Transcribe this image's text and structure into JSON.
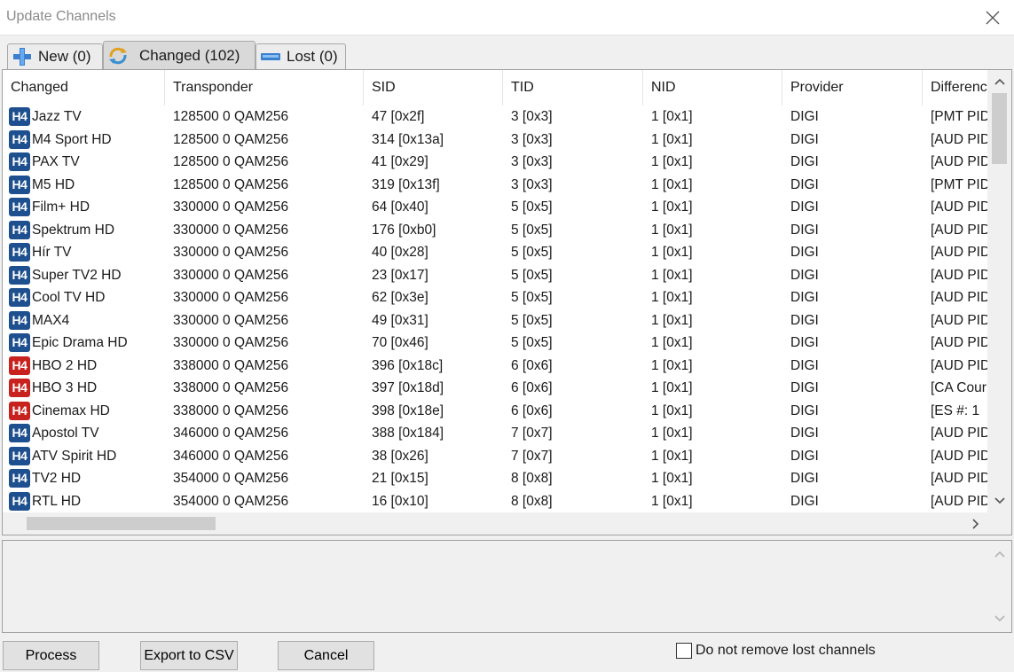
{
  "window": {
    "title": "Update Channels"
  },
  "tabs": [
    {
      "label": "New (0)",
      "icon": "plus-icon",
      "active": false
    },
    {
      "label": "Changed (102)",
      "icon": "refresh-icon",
      "active": true
    },
    {
      "label": "Lost (0)",
      "icon": "minus-icon",
      "active": false
    }
  ],
  "grid": {
    "columns": [
      "Changed",
      "Transponder",
      "SID",
      "TID",
      "NID",
      "Provider",
      "Differenc"
    ],
    "badge_text": "H4",
    "rows": [
      {
        "name": "Jazz TV",
        "badge": "blue",
        "transponder": "128500 0 QAM256",
        "sid": "47 [0x2f]",
        "tid": "3 [0x3]",
        "nid": "1 [0x1]",
        "provider": "DIGI",
        "diff": "[PMT PID"
      },
      {
        "name": "M4 Sport HD",
        "badge": "blue",
        "transponder": "128500 0 QAM256",
        "sid": "314 [0x13a]",
        "tid": "3 [0x3]",
        "nid": "1 [0x1]",
        "provider": "DIGI",
        "diff": "[AUD PID"
      },
      {
        "name": "PAX TV",
        "badge": "blue",
        "transponder": "128500 0 QAM256",
        "sid": "41 [0x29]",
        "tid": "3 [0x3]",
        "nid": "1 [0x1]",
        "provider": "DIGI",
        "diff": "[AUD PID"
      },
      {
        "name": "M5 HD",
        "badge": "blue",
        "transponder": "128500 0 QAM256",
        "sid": "319 [0x13f]",
        "tid": "3 [0x3]",
        "nid": "1 [0x1]",
        "provider": "DIGI",
        "diff": "[PMT PID"
      },
      {
        "name": "Film+ HD",
        "badge": "blue",
        "transponder": "330000 0 QAM256",
        "sid": "64 [0x40]",
        "tid": "5 [0x5]",
        "nid": "1 [0x1]",
        "provider": "DIGI",
        "diff": "[AUD PID"
      },
      {
        "name": "Spektrum HD",
        "badge": "blue",
        "transponder": "330000 0 QAM256",
        "sid": "176 [0xb0]",
        "tid": "5 [0x5]",
        "nid": "1 [0x1]",
        "provider": "DIGI",
        "diff": "[AUD PID"
      },
      {
        "name": "Hír TV",
        "badge": "blue",
        "transponder": "330000 0 QAM256",
        "sid": "40 [0x28]",
        "tid": "5 [0x5]",
        "nid": "1 [0x1]",
        "provider": "DIGI",
        "diff": "[AUD PID"
      },
      {
        "name": "Super TV2 HD",
        "badge": "blue",
        "transponder": "330000 0 QAM256",
        "sid": "23 [0x17]",
        "tid": "5 [0x5]",
        "nid": "1 [0x1]",
        "provider": "DIGI",
        "diff": "[AUD PID"
      },
      {
        "name": "Cool TV HD",
        "badge": "blue",
        "transponder": "330000 0 QAM256",
        "sid": "62 [0x3e]",
        "tid": "5 [0x5]",
        "nid": "1 [0x1]",
        "provider": "DIGI",
        "diff": "[AUD PID"
      },
      {
        "name": "MAX4",
        "badge": "blue",
        "transponder": "330000 0 QAM256",
        "sid": "49 [0x31]",
        "tid": "5 [0x5]",
        "nid": "1 [0x1]",
        "provider": "DIGI",
        "diff": "[AUD PID"
      },
      {
        "name": "Epic Drama HD",
        "badge": "blue",
        "transponder": "330000 0 QAM256",
        "sid": "70 [0x46]",
        "tid": "5 [0x5]",
        "nid": "1 [0x1]",
        "provider": "DIGI",
        "diff": "[AUD PID"
      },
      {
        "name": "HBO 2 HD",
        "badge": "red",
        "transponder": "338000 0 QAM256",
        "sid": "396 [0x18c]",
        "tid": "6 [0x6]",
        "nid": "1 [0x1]",
        "provider": "DIGI",
        "diff": "[AUD PID"
      },
      {
        "name": "HBO 3 HD",
        "badge": "red",
        "transponder": "338000 0 QAM256",
        "sid": "397 [0x18d]",
        "tid": "6 [0x6]",
        "nid": "1 [0x1]",
        "provider": "DIGI",
        "diff": "[CA Cour"
      },
      {
        "name": "Cinemax HD",
        "badge": "red",
        "transponder": "338000 0 QAM256",
        "sid": "398 [0x18e]",
        "tid": "6 [0x6]",
        "nid": "1 [0x1]",
        "provider": "DIGI",
        "diff": "[ES #: 1"
      },
      {
        "name": "Apostol TV",
        "badge": "blue",
        "transponder": "346000 0 QAM256",
        "sid": "388 [0x184]",
        "tid": "7 [0x7]",
        "nid": "1 [0x1]",
        "provider": "DIGI",
        "diff": "[AUD PID"
      },
      {
        "name": "ATV Spirit HD",
        "badge": "blue",
        "transponder": "346000 0 QAM256",
        "sid": "38 [0x26]",
        "tid": "7 [0x7]",
        "nid": "1 [0x1]",
        "provider": "DIGI",
        "diff": "[AUD PID"
      },
      {
        "name": "TV2 HD",
        "badge": "blue",
        "transponder": "354000 0 QAM256",
        "sid": "21 [0x15]",
        "tid": "8 [0x8]",
        "nid": "1 [0x1]",
        "provider": "DIGI",
        "diff": "[AUD PID"
      },
      {
        "name": "RTL HD",
        "badge": "blue",
        "transponder": "354000 0 QAM256",
        "sid": "16 [0x10]",
        "tid": "8 [0x8]",
        "nid": "1 [0x1]",
        "provider": "DIGI",
        "diff": "[AUD PID"
      }
    ]
  },
  "buttons": {
    "process": "Process",
    "export": "Export to CSV",
    "cancel": "Cancel"
  },
  "options": {
    "keep_lost_label": "Do not remove lost channels",
    "keep_lost_checked": false
  },
  "colors": {
    "badge_blue": "#1e4f8f",
    "badge_red": "#c8221f"
  }
}
